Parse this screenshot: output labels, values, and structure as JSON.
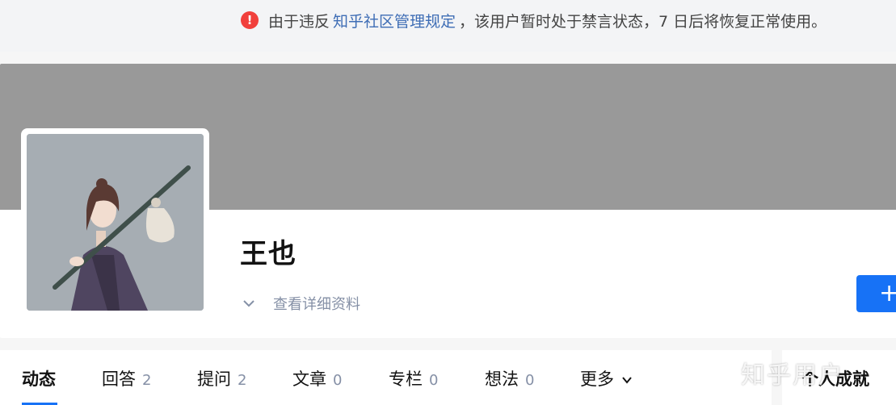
{
  "notice": {
    "icon": "exclamation-circle-icon",
    "prefix": "由于违反",
    "link": "知乎社区管理规定",
    "suffix": "，该用户暂时处于禁言状态，7 日后将恢复正常使用。"
  },
  "profile": {
    "name": "王也",
    "detail_label": "查看详细资料",
    "follow_icon": "+"
  },
  "tabs": [
    {
      "label": "动态",
      "count": ""
    },
    {
      "label": "回答",
      "count": "2"
    },
    {
      "label": "提问",
      "count": "2"
    },
    {
      "label": "文章",
      "count": "0"
    },
    {
      "label": "专栏",
      "count": "0"
    },
    {
      "label": "想法",
      "count": "0"
    },
    {
      "label": "更多",
      "count": ""
    }
  ],
  "sidebar": {
    "title": "个人成就"
  },
  "watermark": "知乎用户",
  "colors": {
    "accent": "#1772f6",
    "warn": "#f1403c",
    "cover": "#999999"
  }
}
